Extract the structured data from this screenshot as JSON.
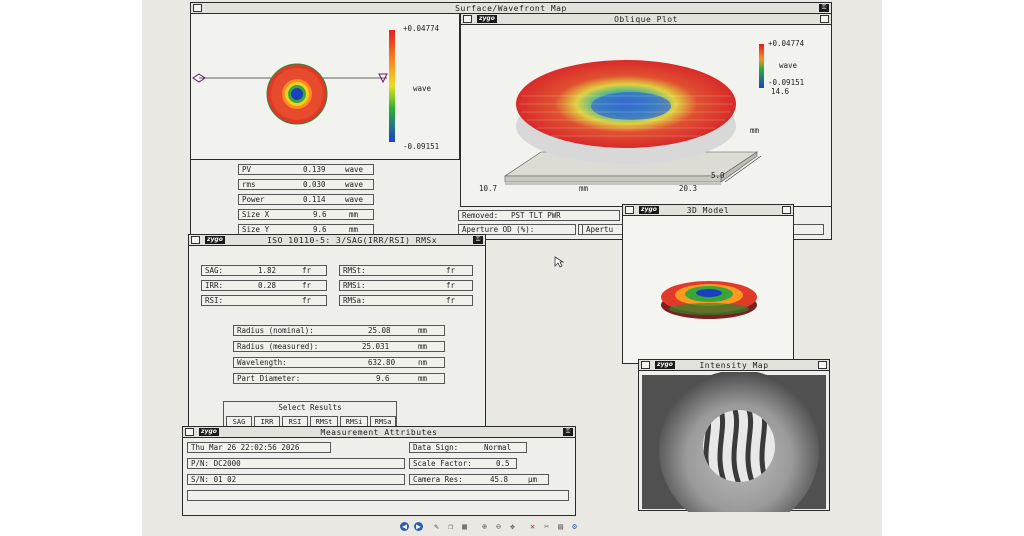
{
  "main_window": {
    "title": "Surface/Wavefront Map"
  },
  "surface_map": {
    "scale_max": "+0.04774",
    "scale_unit": "wave",
    "scale_min": "-0.09151"
  },
  "oblique_plot": {
    "logo": "zygo",
    "title": "Oblique Plot",
    "scale_max": "+0.04774",
    "scale_unit": "wave",
    "scale_min": "-0.09151",
    "scale_extra": "14.6",
    "x_start": "10.7",
    "x_unit": "mm",
    "x_end": "20.3",
    "y_unit": "mm",
    "y_mark": "5.0"
  },
  "stats": [
    {
      "label": "PV",
      "value": "0.139",
      "unit": "wave"
    },
    {
      "label": "rms",
      "value": "0.030",
      "unit": "wave"
    },
    {
      "label": "Power",
      "value": "0.114",
      "unit": "wave"
    },
    {
      "label": "Size X",
      "value": "9.6",
      "unit": "mm"
    },
    {
      "label": "Size Y",
      "value": "9.6",
      "unit": "mm"
    }
  ],
  "removed": {
    "label": "Removed:",
    "value": "PST TLT PWR"
  },
  "aperture_od": {
    "label": "Aperture OD (%):"
  },
  "aperture_trunc": {
    "label": "Apertu"
  },
  "iso_window": {
    "logo": "zygo",
    "title": "ISO 10110-5: 3/SAG(IRR/RSI) RMSx",
    "left_fields": [
      {
        "label": "SAG:",
        "value": "1.82",
        "unit": "fr"
      },
      {
        "label": "IRR:",
        "value": "0.28",
        "unit": "fr"
      },
      {
        "label": "RSI:",
        "value": "",
        "unit": "fr"
      }
    ],
    "right_fields": [
      {
        "label": "RMSt:",
        "unit": "fr"
      },
      {
        "label": "RMSi:",
        "unit": "fr"
      },
      {
        "label": "RMSa:",
        "unit": "fr"
      }
    ],
    "params": [
      {
        "label": "Radius (nominal):",
        "value": "25.08",
        "unit": "mm"
      },
      {
        "label": "Radius (measured):",
        "value": "25.031",
        "unit": "mm"
      },
      {
        "label": "Wavelength:",
        "value": "632.80",
        "unit": "nm"
      },
      {
        "label": "Part Diameter:",
        "value": "9.6",
        "unit": "mm"
      }
    ],
    "select_results": {
      "label": "Select Results",
      "buttons": [
        "SAG",
        "IRR",
        "RSI",
        "RMSt",
        "RMSi",
        "RMSa"
      ]
    }
  },
  "model_window": {
    "logo": "zygo",
    "title": "3D Model"
  },
  "intensity_window": {
    "logo": "zygo",
    "title": "Intensity Map"
  },
  "measurement_window": {
    "logo": "zygo",
    "title": "Measurement Attributes",
    "timestamp": "Thu Mar 26 22:02:56 2026",
    "pn": "P/N: DC2000",
    "sn": "S/N: 01 02",
    "data_sign": {
      "label": "Data Sign:",
      "value": "Normal"
    },
    "scale_factor": {
      "label": "Scale Factor:",
      "value": "0.5"
    },
    "camera_res": {
      "label": "Camera Res:",
      "value": "45.8",
      "unit": "µm"
    }
  },
  "colors": {
    "screen_bg": "#e9e8e2",
    "window_bg": "#eeeeea",
    "map_red": "#e53a2a",
    "map_green": "#3aa63a",
    "map_blue": "#1a3fbf",
    "map_yellow": "#f0d020"
  },
  "icons": [
    "close-box-icon",
    "maximize-box-icon",
    "keys-icon",
    "marker-triangle-icon",
    "taskbar-icons",
    "cursor-arrow-icon"
  ]
}
